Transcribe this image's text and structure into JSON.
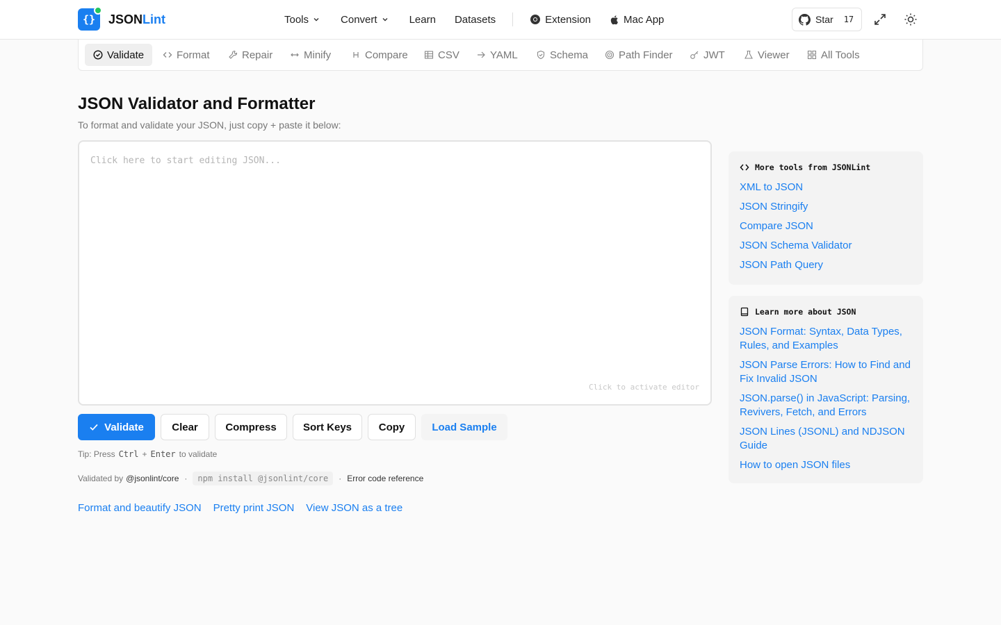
{
  "brand": {
    "name_primary": "JSON",
    "name_accent": "Lint",
    "mark": "{}"
  },
  "nav": {
    "tools": "Tools",
    "convert": "Convert",
    "learn": "Learn",
    "datasets": "Datasets",
    "extension": "Extension",
    "mac_app": "Mac App"
  },
  "github": {
    "label": "Star",
    "count": "17"
  },
  "tabs": [
    {
      "label": "Validate",
      "icon": "check-circle-icon",
      "active": true
    },
    {
      "label": "Format",
      "icon": "code-icon"
    },
    {
      "label": "Repair",
      "icon": "wrench-icon"
    },
    {
      "label": "Minify",
      "icon": "arrows-horizontal-icon"
    },
    {
      "label": "Compare",
      "icon": "compare-icon"
    },
    {
      "label": "CSV",
      "icon": "table-icon"
    },
    {
      "label": "YAML",
      "icon": "arrow-right-icon"
    },
    {
      "label": "Schema",
      "icon": "shield-check-icon"
    },
    {
      "label": "Path Finder",
      "icon": "target-icon"
    },
    {
      "label": "JWT",
      "icon": "key-icon"
    },
    {
      "label": "Viewer",
      "icon": "flask-icon"
    },
    {
      "label": "All Tools",
      "icon": "grid-icon"
    }
  ],
  "main": {
    "title": "JSON Validator and Formatter",
    "subtitle": "To format and validate your JSON, just copy + paste it below:",
    "editor_placeholder": "Click here to start editing JSON...",
    "editor_hint": "Click to activate editor"
  },
  "actions": {
    "validate": "Validate",
    "clear": "Clear",
    "compress": "Compress",
    "sort_keys": "Sort Keys",
    "copy": "Copy",
    "load_sample": "Load Sample"
  },
  "tip": {
    "prefix": "Tip: Press",
    "key1": "Ctrl",
    "plus": "+",
    "key2": "Enter",
    "suffix": "to validate"
  },
  "validated": {
    "prefix": "Validated by",
    "package": "@jsonlint/core",
    "sep": "·",
    "install": "npm install @jsonlint/core",
    "error_ref": "Error code reference"
  },
  "bottom_links": [
    "Format and beautify JSON",
    "Pretty print JSON",
    "View JSON as a tree"
  ],
  "sidebar": {
    "more_tools": {
      "title": "More tools from JSONLint",
      "links": [
        "XML to JSON",
        "JSON Stringify",
        "Compare JSON",
        "JSON Schema Validator",
        "JSON Path Query"
      ]
    },
    "learn_more": {
      "title": "Learn more about JSON",
      "links": [
        "JSON Format: Syntax, Data Types, Rules, and Examples",
        "JSON Parse Errors: How to Find and Fix Invalid JSON",
        "JSON.parse() in JavaScript: Parsing, Revivers, Fetch, and Errors",
        "JSON Lines (JSONL) and NDJSON Guide",
        "How to open JSON files"
      ]
    }
  },
  "colors": {
    "accent": "#1a7ff0",
    "success": "#22c55e",
    "background": "#fafafa"
  }
}
